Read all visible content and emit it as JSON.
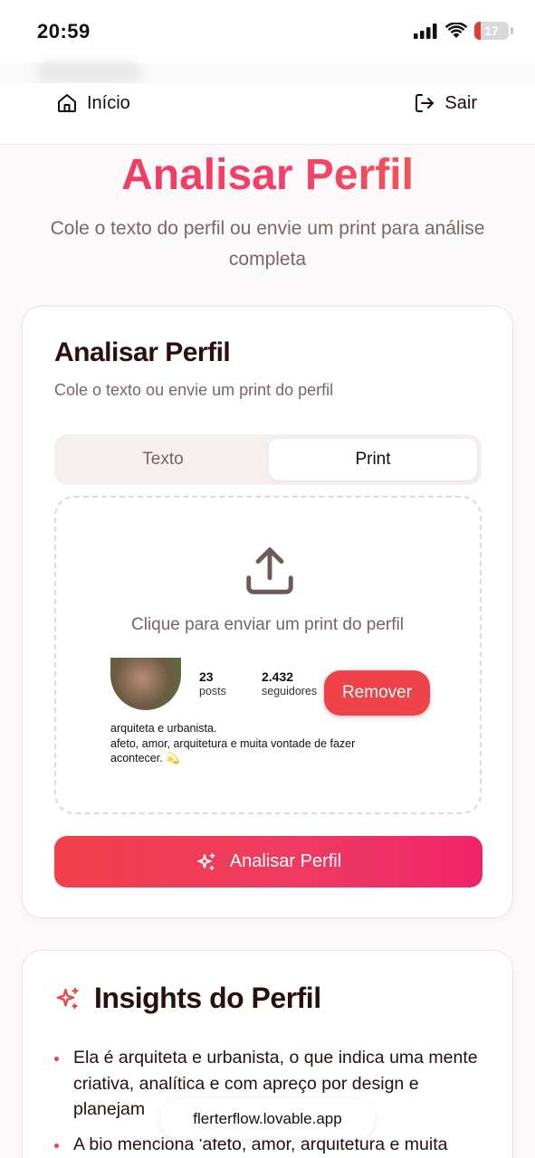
{
  "status_bar": {
    "time": "20:59",
    "battery_level": "17",
    "icons": [
      "signal-icon",
      "wifi-icon",
      "battery-icon"
    ]
  },
  "nav": {
    "home_label": "Início",
    "logout_label": "Sair"
  },
  "hero": {
    "title": "Analisar Perfil",
    "subtitle": "Cole o texto do perfil ou envie um print para análise completa"
  },
  "analyze_card": {
    "title": "Analisar Perfil",
    "subtitle": "Cole o texto ou envie um print do perfil",
    "tabs": [
      {
        "label": "Texto",
        "active": false
      },
      {
        "label": "Print",
        "active": true
      }
    ],
    "upload_label": "Clique para enviar um print do perfil",
    "preview": {
      "posts_count": "23",
      "posts_label": "posts",
      "followers_count": "2.432",
      "followers_label": "seguidores",
      "bio_line1": "arquiteta e urbanista.",
      "bio_line2": "afeto, amor, arquitetura e muita vontade de fazer",
      "bio_line3": "acontecer. 💫"
    },
    "remove_label": "Remover",
    "submit_label": "Analisar Perfil"
  },
  "insights": {
    "title": "Insights do Perfil",
    "items": [
      "Ela é arquiteta e urbanista, o que indica uma mente criativa, analítica e com apreço por design e planejam",
      "A bio menciona 'afeto, amor, arquitetura e muita"
    ]
  },
  "browser": {
    "url": "flerterflow.lovable.app"
  },
  "colors": {
    "accent": "#ee4348",
    "gradient_start": "#f0404b",
    "gradient_end": "#f0246a",
    "text_dark": "#2a0f0f",
    "text_muted": "#776565"
  }
}
